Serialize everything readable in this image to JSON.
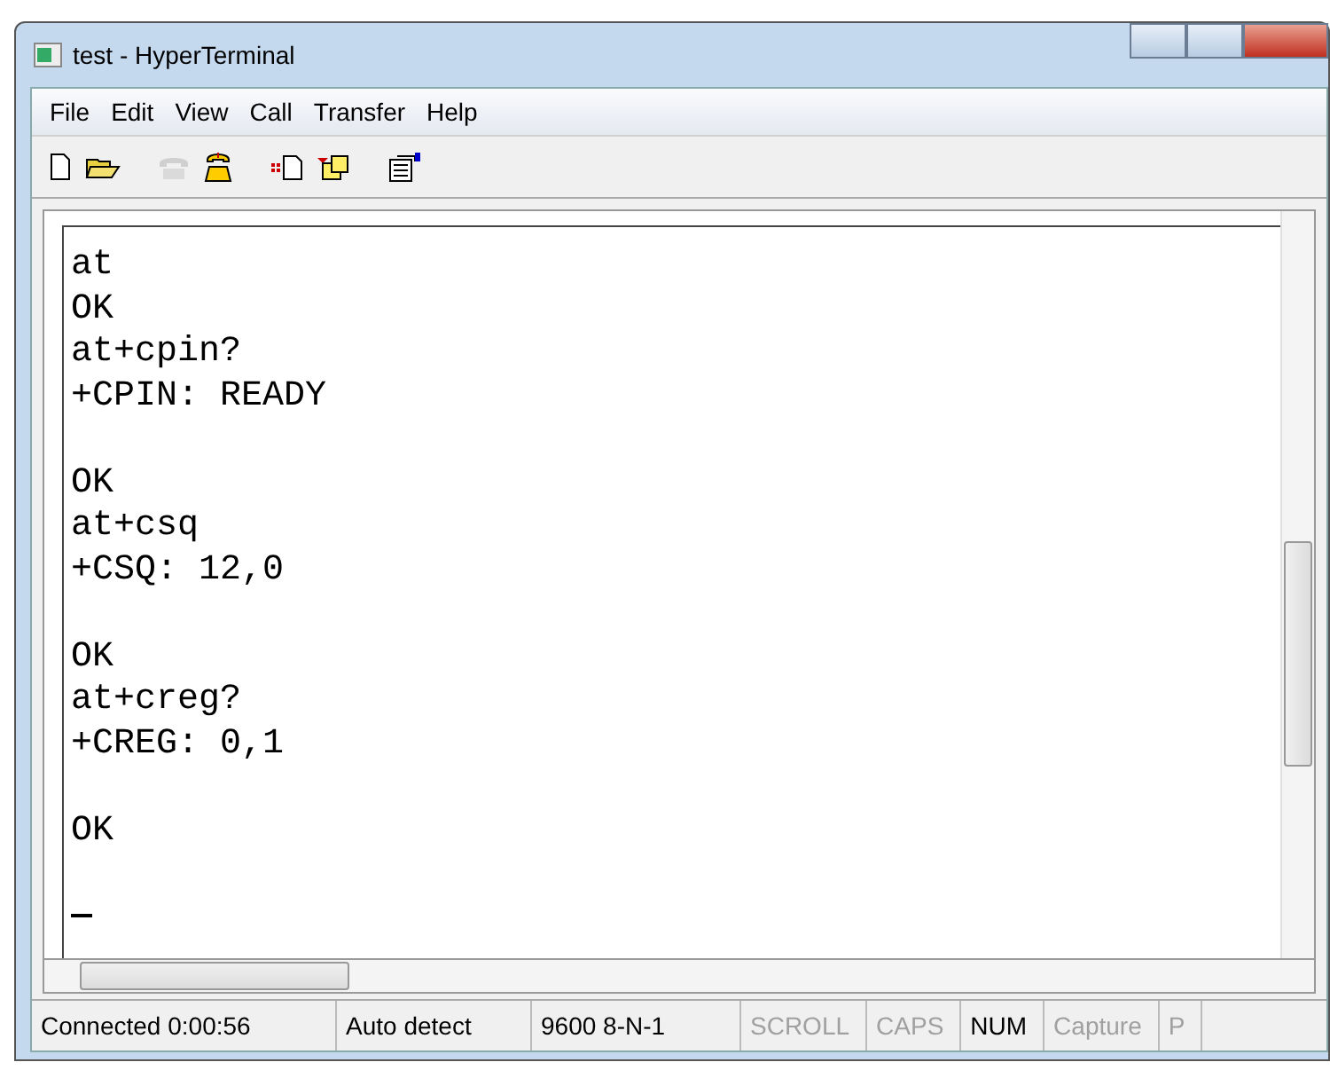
{
  "window": {
    "title": "test - HyperTerminal"
  },
  "menu": [
    "File",
    "Edit",
    "View",
    "Call",
    "Transfer",
    "Help"
  ],
  "toolbar": [
    {
      "kind": "new",
      "disabled": false
    },
    {
      "kind": "open",
      "disabled": false
    },
    {
      "kind": "gap"
    },
    {
      "kind": "phone",
      "disabled": true
    },
    {
      "kind": "dialing",
      "disabled": false
    },
    {
      "kind": "gap"
    },
    {
      "kind": "send",
      "disabled": false
    },
    {
      "kind": "receive",
      "disabled": false
    },
    {
      "kind": "gap"
    },
    {
      "kind": "properties",
      "disabled": false
    }
  ],
  "terminal": {
    "lines": [
      {
        "kind": "text",
        "text": "at"
      },
      {
        "kind": "text",
        "text": "OK"
      },
      {
        "kind": "text",
        "text": "at+cpin?"
      },
      {
        "kind": "text",
        "text": "+CPIN: READY"
      },
      {
        "kind": "blank"
      },
      {
        "kind": "text",
        "text": "OK"
      },
      {
        "kind": "text",
        "text": "at+csq"
      },
      {
        "kind": "text",
        "text": "+CSQ: 12,0"
      },
      {
        "kind": "blank"
      },
      {
        "kind": "text",
        "text": "OK"
      },
      {
        "kind": "text",
        "text": "at+creg?"
      },
      {
        "kind": "text",
        "text": "+CREG: 0,1"
      },
      {
        "kind": "blank"
      },
      {
        "kind": "text",
        "text": "OK"
      },
      {
        "kind": "blank"
      },
      {
        "kind": "cursor"
      }
    ]
  },
  "status_bar": [
    {
      "text": "Connected 0:00:56",
      "disabled": false
    },
    {
      "text": "Auto detect",
      "disabled": false
    },
    {
      "text": "9600 8-N-1",
      "disabled": false
    },
    {
      "text": "SCROLL",
      "disabled": true
    },
    {
      "text": "CAPS",
      "disabled": true
    },
    {
      "text": "NUM",
      "disabled": false
    },
    {
      "text": "Capture",
      "disabled": true
    },
    {
      "text": "P",
      "disabled": true
    }
  ]
}
